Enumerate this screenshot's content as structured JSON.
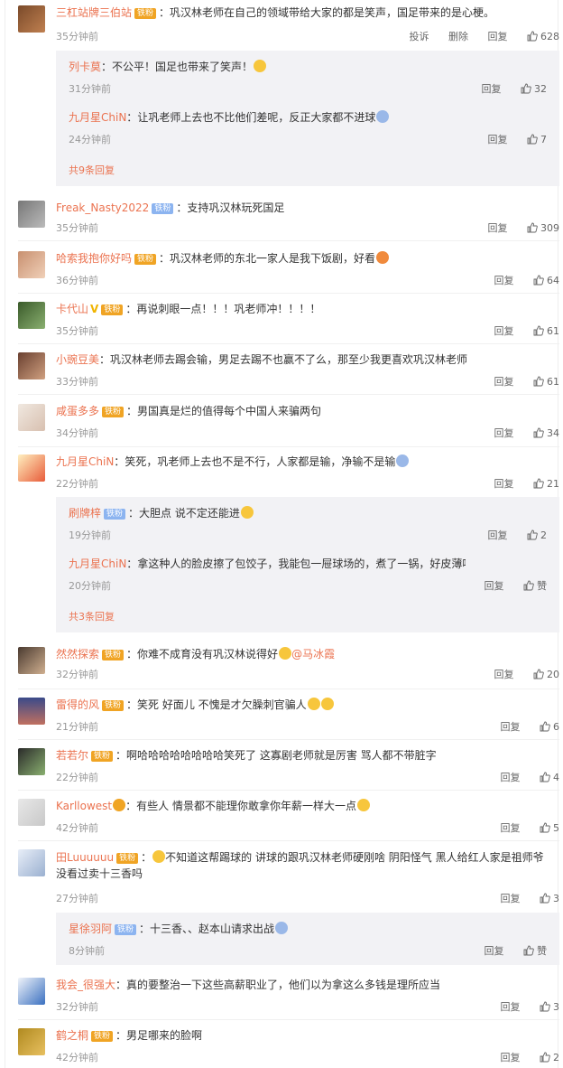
{
  "labels": {
    "reply": "回复",
    "delete": "删除",
    "report": "投诉"
  },
  "comments": [
    {
      "user": "三杠站牌三伯站",
      "badge": "铁粉",
      "text": "巩汉林老师在自己的领域带给大家的都是笑声，国足带来的是心梗。",
      "time": "35分钟前",
      "likes": "628",
      "avatar": "user-avatar"
    },
    {
      "user": "Freak_Nasty2022",
      "badge": "铁粉",
      "text": "支持巩汉林玩死国足",
      "time": "35分钟前",
      "likes": "309",
      "avatar": "user-avatar"
    },
    {
      "user": "哈索我抱你好吗",
      "badge": "铁粉",
      "text": "巩汉林老师的东北一家人是我下饭剧，好看",
      "time": "36分钟前",
      "likes": "64",
      "avatar": "user-avatar"
    },
    {
      "user": "卡代山",
      "badge": "铁粉",
      "text": "再说刺眼一点！！！巩老师冲！！！！",
      "time": "35分钟前",
      "likes": "61",
      "avatar": "user-avatar"
    },
    {
      "user": "小豌豆美",
      "badge": "铁粉",
      "text": "巩汉林老师去踢会输，男足去踢不也赢不了么，那至少我更喜欢巩汉林老师",
      "time": "33分钟前",
      "likes": "61",
      "avatar": "user-avatar"
    },
    {
      "user": "咸蛋多多",
      "badge": "铁粉",
      "text": "男国真是烂的值得每个中国人来骗两句",
      "time": "34分钟前",
      "likes": "34",
      "avatar": "user-avatar"
    },
    {
      "user": "九月星ChiN",
      "badge": "",
      "text": "笑死，巩老师上去也不是不行，人家都是输，净输不是输",
      "time": "22分钟前",
      "likes": "21",
      "avatar": "user-avatar"
    },
    {
      "user": "然然探索",
      "badge": "铁粉",
      "text": "你难不成育没有巩汉林说得好",
      "mention": "@马冰霞",
      "time": "32分钟前",
      "likes": "20",
      "avatar": "user-avatar"
    },
    {
      "user": "雷得的风",
      "badge": "铁粉",
      "text": "笑死 好面儿 不愧是才欠臊刺官骗人",
      "time": "21分钟前",
      "likes": "6",
      "avatar": "user-avatar"
    },
    {
      "user": "若若尔",
      "badge": "铁粉",
      "text": "啊哈哈哈哈哈哈哈哈笑死了 这寡剧老师就是厉害 骂人都不带脏字",
      "time": "22分钟前",
      "likes": "4",
      "avatar": "user-avatar"
    },
    {
      "user": "Karllowest",
      "badge": "",
      "text": "有些人 情景都不能理你敢拿你年薪一样大一点",
      "time": "42分钟前",
      "likes": "5",
      "avatar": "user-avatar"
    },
    {
      "user": "田Luuuuuu",
      "badge": "铁粉",
      "text": "不知道这帮踢球的 讲球的跟巩汉林老师硬刚啥 阴阳怪气 黑人给红人家是祖师爷 没看过卖十三香吗",
      "time": "27分钟前",
      "likes": "3",
      "avatar": "user-avatar"
    },
    {
      "user": "我会_很强大",
      "badge": "",
      "text": "真的要整治一下这些高薪职业了，他们以为拿这么多钱是理所应当",
      "time": "32分钟前",
      "likes": "3",
      "avatar": "user-avatar"
    },
    {
      "user": "鹤之桐",
      "badge": "铁粉",
      "text": "男足哪来的脸啊",
      "time": "42分钟前",
      "likes": "2",
      "avatar": "user-avatar"
    }
  ],
  "reply_groups": [
    {
      "replies": [
        {
          "user": "列卡莫",
          "text": "不公平！国足也带来了笑声！",
          "time": "31分钟前",
          "likes": "32"
        },
        {
          "user": "九月星ChiN",
          "text": "让巩老师上去也不比他们差呢，反正大家都不进球",
          "time": "24分钟前",
          "likes": "7"
        }
      ],
      "more": "共9条回复"
    },
    {
      "replies": [
        {
          "user": "刷牌梓",
          "badge": "铁粉",
          "text": "大胆点 说不定还能进",
          "time": "19分钟前",
          "likes": "2"
        },
        {
          "user": "九月星ChiN",
          "text": "拿这种人的脸皮擦了包饺子，我能包一屉球场的，煮了一锅，好皮薄呀",
          "time": "20分钟前",
          "likes": "赞"
        }
      ],
      "more": "共3条回复"
    },
    {
      "replies": [
        {
          "user": "星徐羽阿",
          "badge": "铁粉",
          "text": "十三香、、赵本山请求出战",
          "time": "8分钟前",
          "likes": "赞"
        }
      ],
      "more": ""
    }
  ],
  "colors": {
    "username": "#eb7350",
    "badge_gold": "#f0a424",
    "badge_blue": "#8cb4f0",
    "reply_bg": "#f2f2f5"
  }
}
